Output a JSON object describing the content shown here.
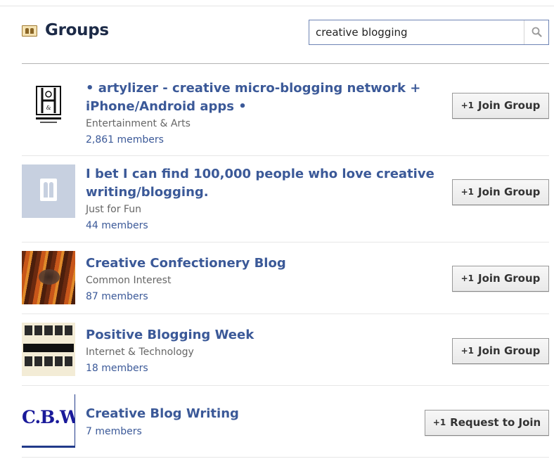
{
  "header": {
    "title": "Groups",
    "icon": "groups-icon"
  },
  "search": {
    "value": "creative blogging",
    "button_icon": "search-icon"
  },
  "results": [
    {
      "name": "• artylizer - creative micro-blogging network + iPhone/Android apps •",
      "category": "Entertainment & Arts",
      "members": "2,861 members",
      "action": "Join Group",
      "thumbnail": "hollander-crest-logo"
    },
    {
      "name": "I bet I can find 100,000 people who love creative writing/blogging.",
      "category": "Just for Fun",
      "members": "44 members",
      "action": "Join Group",
      "thumbnail": "default-group-icon"
    },
    {
      "name": "Creative Confectionery Blog",
      "category": "Common Interest",
      "members": "87 members",
      "action": "Join Group",
      "thumbnail": "confectionery-photo"
    },
    {
      "name": "Positive Blogging Week",
      "category": "Internet & Technology",
      "members": "18 members",
      "action": "Join Group",
      "thumbnail": "positive-blogging-poster"
    },
    {
      "name": "Creative Blog Writing",
      "members": "7 members",
      "action": "Request to Join",
      "thumbnail": "cbw-logo",
      "thumbnail_text": "C.B.W"
    }
  ],
  "colors": {
    "link": "#3b5998",
    "title": "#1c2a47",
    "muted": "#666666"
  }
}
